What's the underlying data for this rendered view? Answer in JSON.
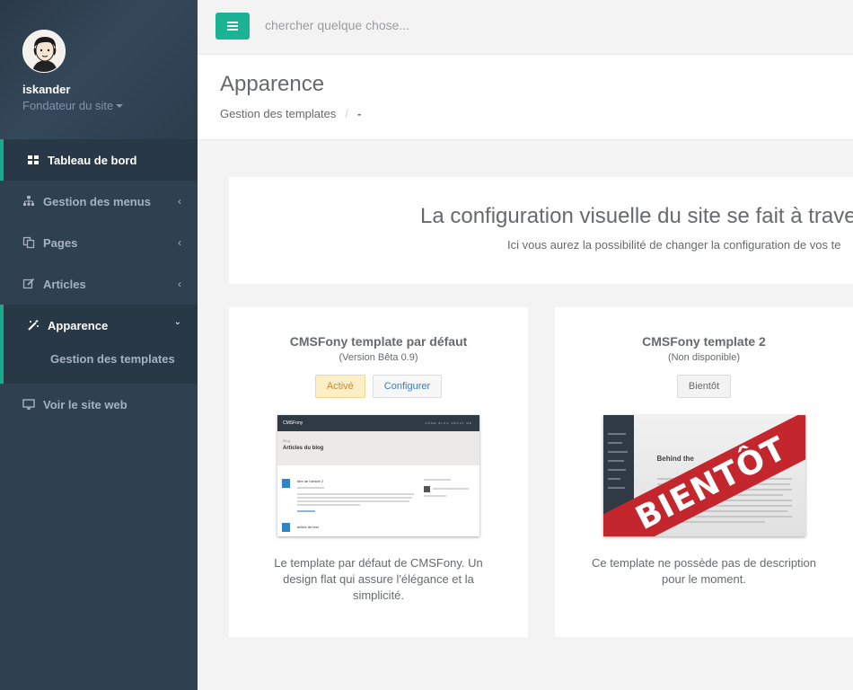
{
  "user": {
    "name": "iskander",
    "role": "Fondateur du site"
  },
  "sidebar": {
    "items": [
      {
        "label": "Tableau de bord"
      },
      {
        "label": "Gestion des menus"
      },
      {
        "label": "Pages"
      },
      {
        "label": "Articles"
      },
      {
        "label": "Apparence"
      },
      {
        "label": "Voir le site web"
      }
    ],
    "sub_items": [
      {
        "label": "Gestion des templates"
      }
    ]
  },
  "topbar": {
    "search_placeholder": "chercher quelque chose..."
  },
  "page": {
    "title": "Apparence",
    "breadcrumb": [
      "Gestion des templates",
      "/",
      "-"
    ]
  },
  "intro": {
    "title": "La configuration visuelle du site se fait à trave",
    "subtitle": "Ici vous aurez la possibilité de changer la configuration de vos te"
  },
  "templates": [
    {
      "title": "CMSFony template par défaut",
      "version": "(Version Bêta 0.9)",
      "buttons": [
        "Activé",
        "Configurer"
      ],
      "description": "Le template par défaut de CMSFony. Un design flat qui assure l'élégance et la simplicité.",
      "preview": {
        "brand": "CMSFony",
        "nav": "HOME   BLOG   ABOUT ME",
        "hero_small": "Blog",
        "hero_title": "Articles du blog",
        "post1": "titre de l'article 2",
        "post2": "article de test"
      }
    },
    {
      "title": "CMSFony template 2",
      "version": "(Non disponible)",
      "buttons": [
        "Bientôt"
      ],
      "description": "Ce template ne possède pas de description pour le moment.",
      "preview": {
        "overlay": "BIENTÔT",
        "heading": "Behind the"
      }
    }
  ],
  "colors": {
    "sidebar": "#2f4050",
    "accent": "#1ab394",
    "ribbon": "#c4262e"
  }
}
